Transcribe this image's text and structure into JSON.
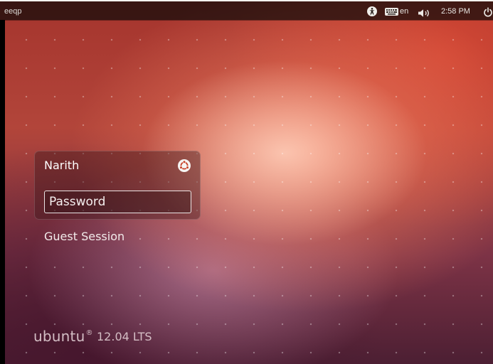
{
  "top_panel": {
    "hostname": "eeqp",
    "keyboard_layout": "en",
    "clock": "2:58 PM",
    "icons": [
      "accessibility-icon",
      "keyboard-icon",
      "volume-icon",
      "power-icon"
    ]
  },
  "greeter": {
    "username": "Narith",
    "password_placeholder": "Password",
    "guest_session": "Guest Session",
    "session_icon": "ubuntu-session-icon"
  },
  "branding": {
    "logo_text": "ubuntu",
    "registered_mark": "®",
    "version": "12.04 LTS"
  },
  "colors": {
    "panel": "#0e0a08",
    "accent_orange": "#dd4814",
    "text": "#ffffff"
  }
}
